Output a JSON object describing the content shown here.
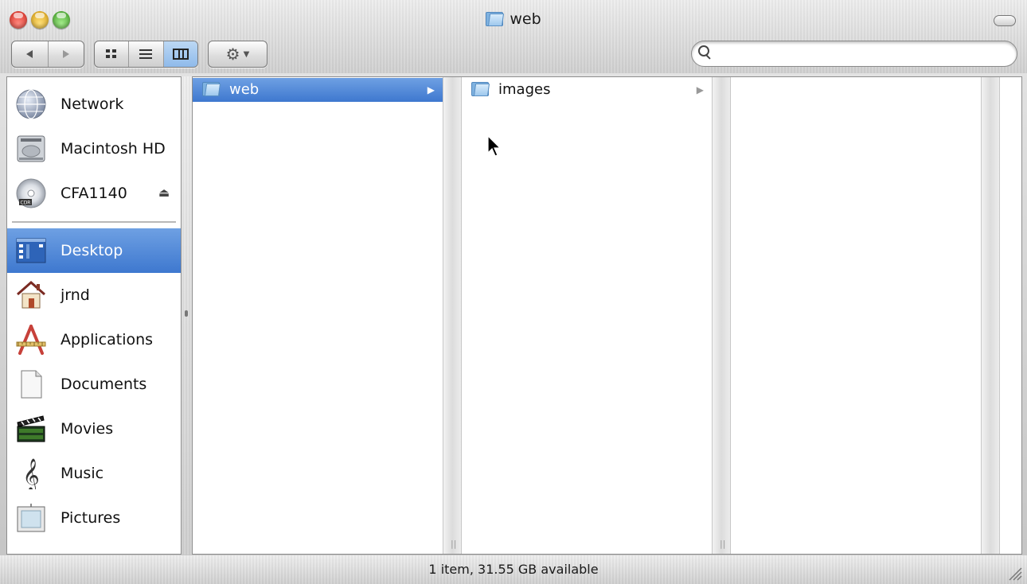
{
  "window": {
    "title": "web"
  },
  "toolbar": {
    "back_icon": "back-arrow-icon",
    "forward_icon": "forward-arrow-icon",
    "views": [
      "icon-view-icon",
      "list-view-icon",
      "column-view-icon"
    ],
    "active_view": "column",
    "action_icon": "gear-icon",
    "search": {
      "value": "",
      "placeholder": ""
    }
  },
  "sidebar": {
    "devices": [
      {
        "label": "Network",
        "icon": "network-globe-icon"
      },
      {
        "label": "Macintosh HD",
        "icon": "hard-drive-icon"
      },
      {
        "label": "CFA1140",
        "icon": "cdr-disc-icon",
        "ejectable": true
      }
    ],
    "places": [
      {
        "label": "Desktop",
        "icon": "desktop-icon",
        "selected": true
      },
      {
        "label": "jrnd",
        "icon": "home-icon"
      },
      {
        "label": "Applications",
        "icon": "applications-icon"
      },
      {
        "label": "Documents",
        "icon": "documents-icon"
      },
      {
        "label": "Movies",
        "icon": "movies-clapper-icon"
      },
      {
        "label": "Music",
        "icon": "music-clef-icon"
      },
      {
        "label": "Pictures",
        "icon": "pictures-frame-icon"
      }
    ]
  },
  "columns": [
    {
      "items": [
        {
          "label": "web",
          "type": "folder",
          "selected": true,
          "has_children": true
        }
      ]
    },
    {
      "items": [
        {
          "label": "images",
          "type": "folder",
          "selected": false,
          "has_children": true
        }
      ]
    },
    {
      "items": []
    }
  ],
  "status": {
    "text": "1 item, 31.55 GB available"
  },
  "colors": {
    "selection": "#3e78cf",
    "folder_blue": "#7fb2e0"
  }
}
